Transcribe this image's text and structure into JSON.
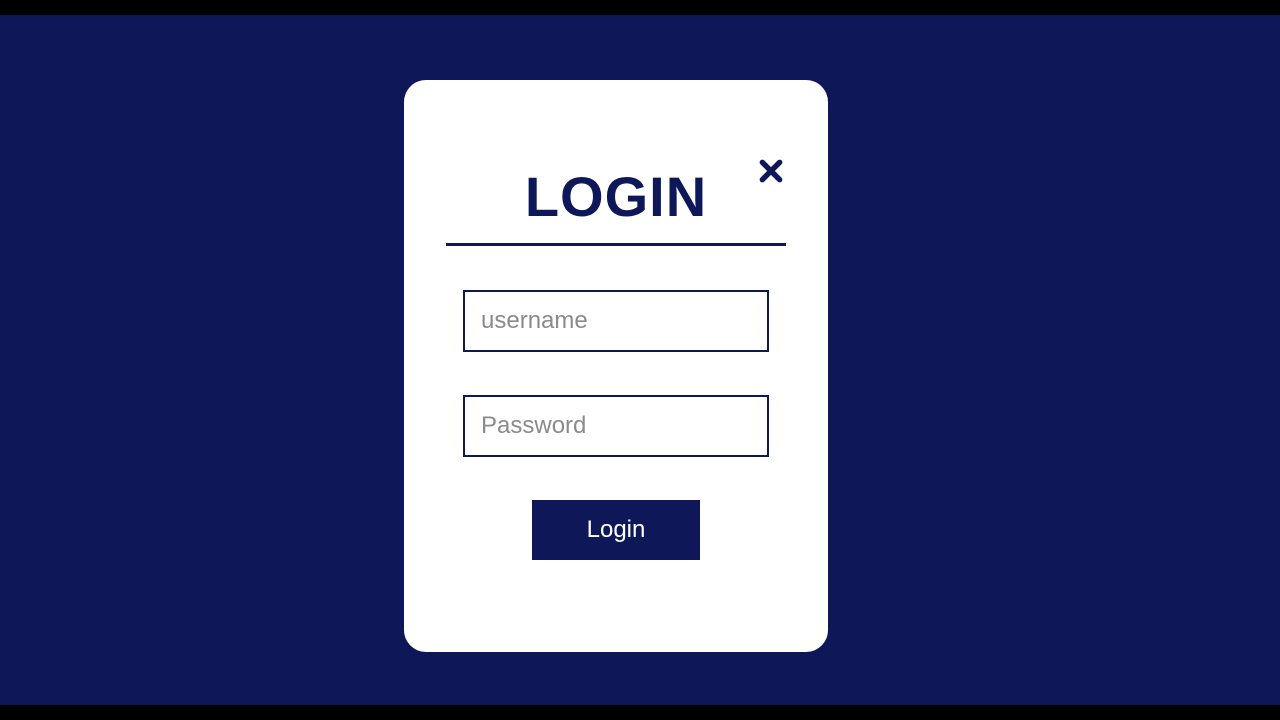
{
  "modal": {
    "title": "LOGIN",
    "username_placeholder": "username",
    "password_placeholder": "Password",
    "login_button_label": "Login"
  },
  "colors": {
    "background": "#0e1858",
    "modal_bg": "#ffffff",
    "accent": "#0e1858",
    "placeholder": "#8b8b8b"
  }
}
